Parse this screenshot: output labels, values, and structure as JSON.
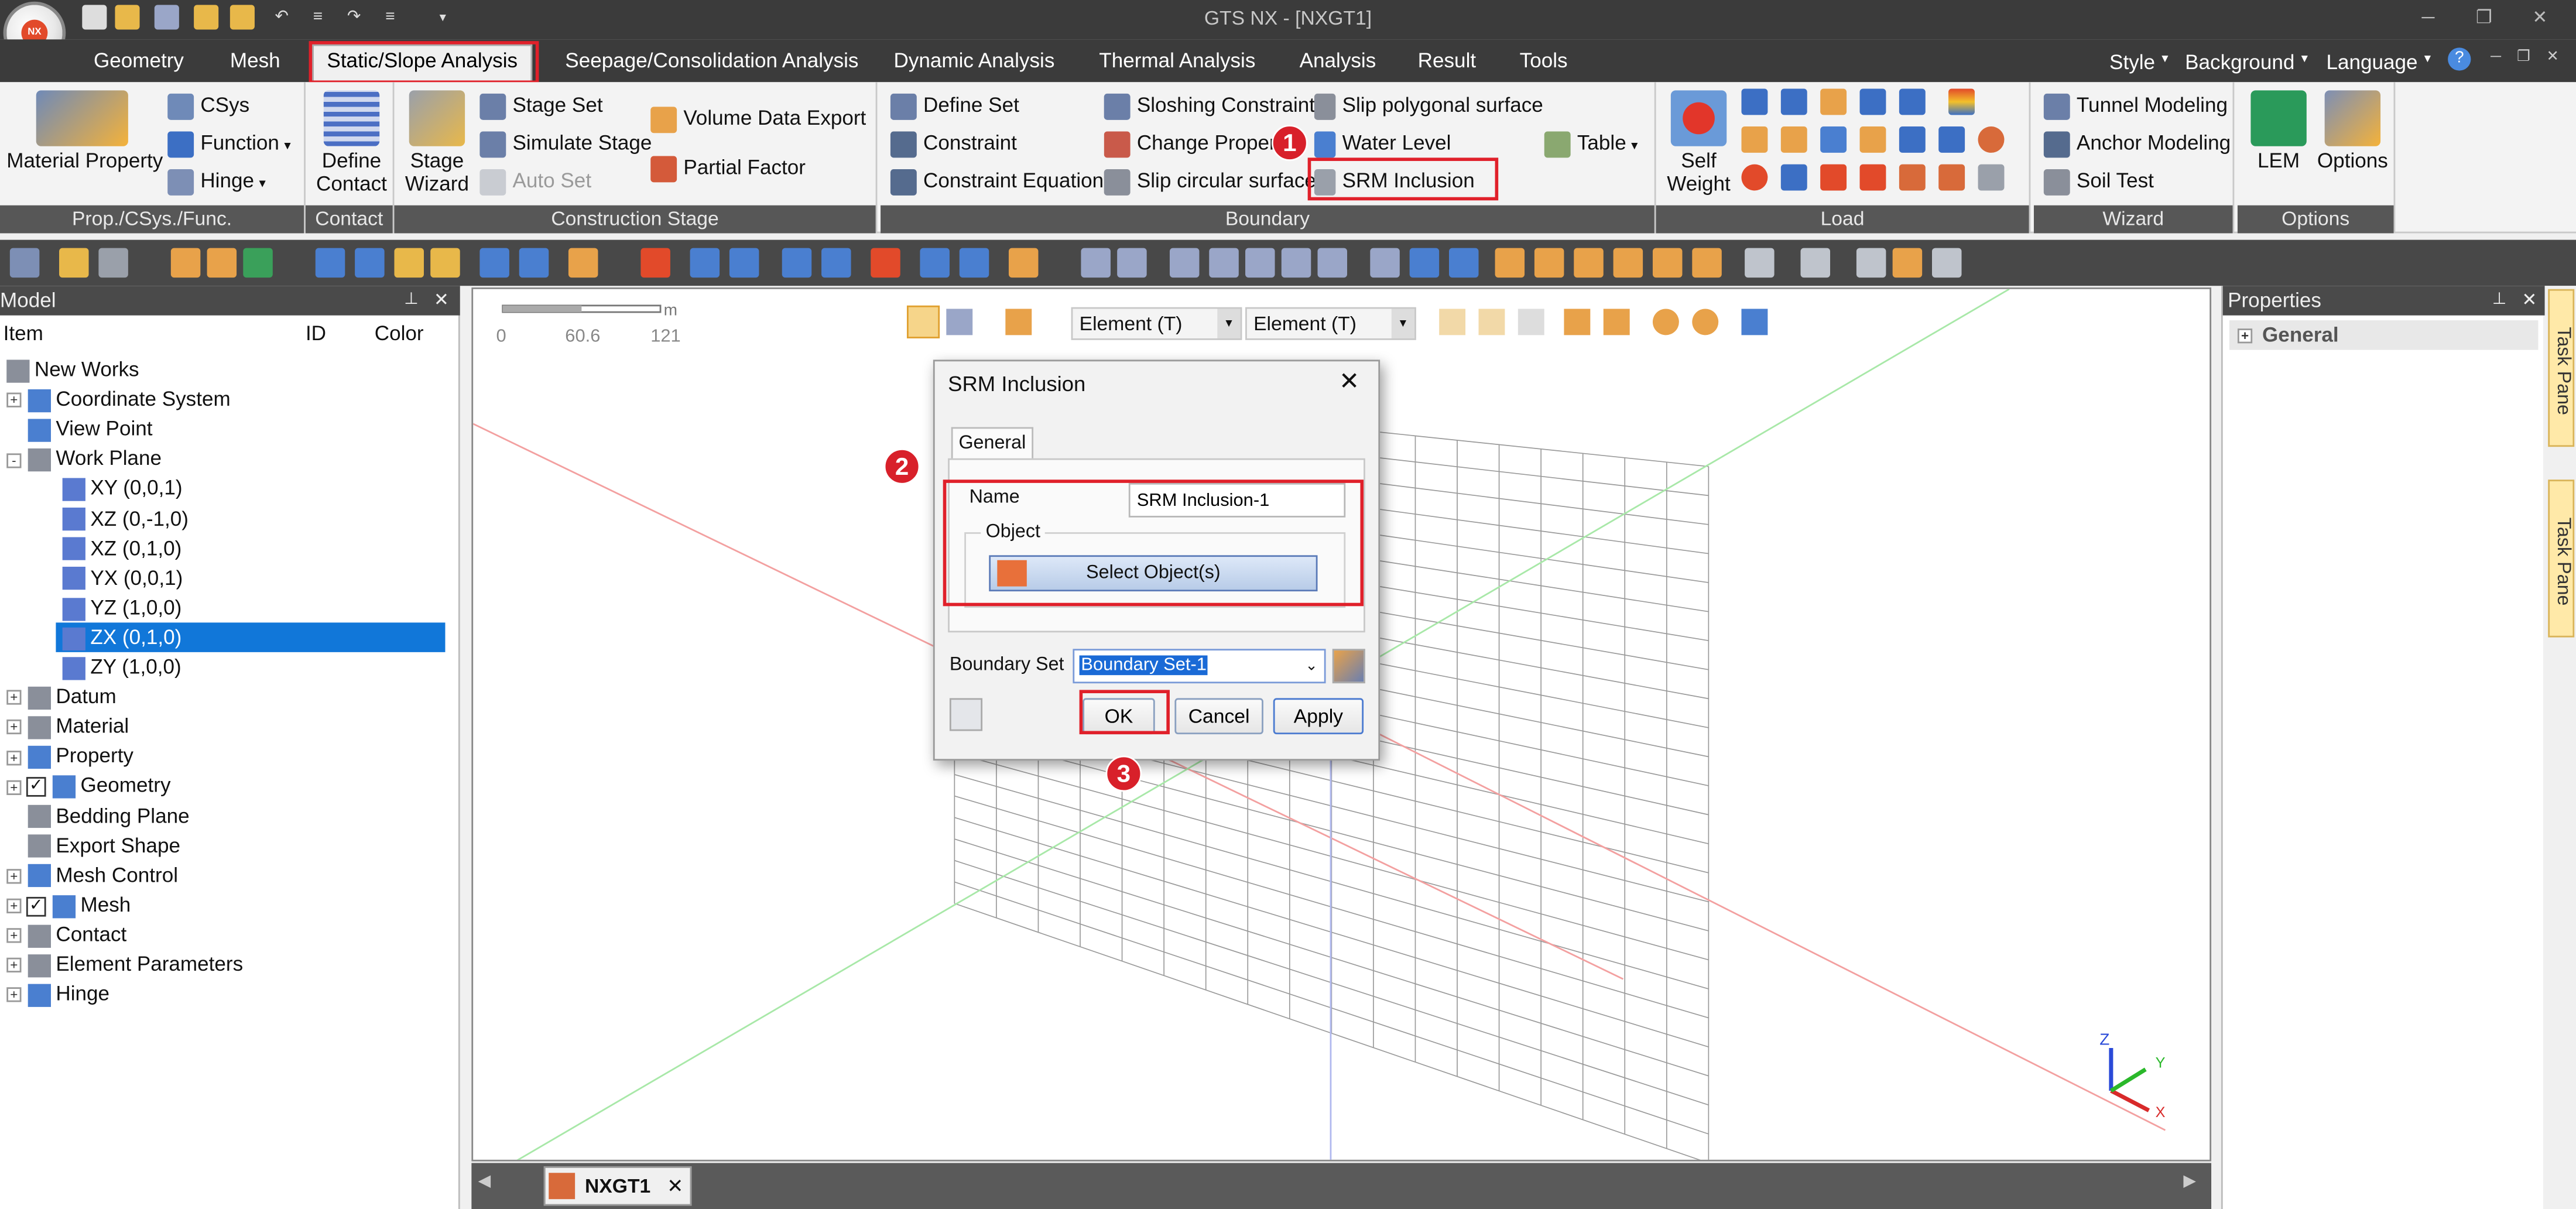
{
  "window": {
    "title": "GTS NX - [NXGT1]",
    "logo_text": "NX"
  },
  "menu": {
    "tabs": [
      "Geometry",
      "Mesh",
      "Static/Slope Analysis",
      "Seepage/Consolidation Analysis",
      "Dynamic Analysis",
      "Thermal Analysis",
      "Analysis",
      "Result",
      "Tools"
    ],
    "right": [
      "Style",
      "Background",
      "Language"
    ]
  },
  "ribbon": {
    "propcsys": {
      "material_property": "Material Property",
      "csys": "CSys",
      "function": "Function",
      "hinge": "Hinge",
      "label": "Prop./CSys./Func."
    },
    "contact": {
      "define": "Define",
      "contact": "Contact",
      "label": "Contact"
    },
    "construction": {
      "stage_wizard_1": "Stage",
      "stage_wizard_2": "Wizard",
      "stage_set": "Stage Set",
      "simulate_stage": "Simulate Stage",
      "auto_set": "Auto Set",
      "volume_data_export": "Volume Data Export",
      "partial_factor": "Partial Factor",
      "label": "Construction Stage"
    },
    "boundary": {
      "define_set": "Define Set",
      "constraint": "Constraint",
      "constraint_equation": "Constraint Equation",
      "sloshing_constraint": "Sloshing Constraint",
      "change_property": "Change Property",
      "slip_circular_surface": "Slip circular surface",
      "slip_polygonal_surface": "Slip polygonal surface",
      "water_level": "Water Level",
      "srm_inclusion": "SRM Inclusion",
      "table": "Table",
      "label": "Boundary"
    },
    "load": {
      "self_weight_1": "Self",
      "self_weight_2": "Weight",
      "label": "Load"
    },
    "wizard": {
      "tunnel_modeling": "Tunnel Modeling",
      "anchor_modeling": "Anchor Modeling",
      "soil_test": "Soil Test",
      "label": "Wizard"
    },
    "options": {
      "lem": "LEM",
      "options": "Options",
      "label": "Options"
    }
  },
  "model_panel": {
    "title": "Model",
    "columns": [
      "Item",
      "ID",
      "Color"
    ],
    "items": [
      {
        "label": "New Works",
        "level": 0,
        "expand": "",
        "check": false
      },
      {
        "label": "Coordinate System",
        "level": 1,
        "expand": "+",
        "check": false
      },
      {
        "label": "View Point",
        "level": 1,
        "expand": "",
        "check": false
      },
      {
        "label": "Work Plane",
        "level": 1,
        "expand": "-",
        "check": false
      },
      {
        "label": "XY (0,0,1)",
        "level": 2,
        "expand": "",
        "check": false
      },
      {
        "label": "XZ (0,-1,0)",
        "level": 2,
        "expand": "",
        "check": false
      },
      {
        "label": "XZ (0,1,0)",
        "level": 2,
        "expand": "",
        "check": false
      },
      {
        "label": "YX (0,0,1)",
        "level": 2,
        "expand": "",
        "check": false
      },
      {
        "label": "YZ (1,0,0)",
        "level": 2,
        "expand": "",
        "check": false
      },
      {
        "label": "ZX (0,1,0)",
        "level": 2,
        "expand": "",
        "check": false,
        "selected": true
      },
      {
        "label": "ZY (1,0,0)",
        "level": 2,
        "expand": "",
        "check": false
      },
      {
        "label": "Datum",
        "level": 1,
        "expand": "+",
        "check": false
      },
      {
        "label": "Material",
        "level": 1,
        "expand": "+",
        "check": false
      },
      {
        "label": "Property",
        "level": 1,
        "expand": "+",
        "check": false
      },
      {
        "label": "Geometry",
        "level": 1,
        "expand": "+",
        "check": true
      },
      {
        "label": "Bedding Plane",
        "level": 1,
        "expand": "",
        "check": false
      },
      {
        "label": "Export Shape",
        "level": 1,
        "expand": "",
        "check": false
      },
      {
        "label": "Mesh Control",
        "level": 1,
        "expand": "+",
        "check": false
      },
      {
        "label": "Mesh",
        "level": 1,
        "expand": "+",
        "check": true
      },
      {
        "label": "Contact",
        "level": 1,
        "expand": "+",
        "check": false
      },
      {
        "label": "Element Parameters",
        "level": 1,
        "expand": "+",
        "check": false
      },
      {
        "label": "Hinge",
        "level": 1,
        "expand": "+",
        "check": false
      }
    ]
  },
  "viewport": {
    "scale_unit": "m",
    "scale_ticks": [
      "0",
      "60.6",
      "121"
    ],
    "filter1": "Element (T)",
    "filter2": "Element (T)",
    "axes": {
      "z": "Z",
      "y": "Y",
      "x": "X"
    },
    "doc_tab": "NXGT1"
  },
  "dialog": {
    "title": "SRM Inclusion",
    "tab": "General",
    "name_label": "Name",
    "name_value": "SRM Inclusion-1",
    "object_label": "Object",
    "select_button": "Select Object(s)",
    "boundary_set_label": "Boundary Set",
    "boundary_set_value": "Boundary Set-1",
    "ok": "OK",
    "cancel": "Cancel",
    "apply": "Apply"
  },
  "properties_panel": {
    "title": "Properties",
    "section": "General"
  },
  "task_pane": {
    "label": "Task Pane"
  },
  "annotations": [
    "1",
    "2",
    "3"
  ],
  "colors": {
    "highlight": "#e0202a",
    "selection": "#1177d9",
    "dark_bar": "#3b3b3b",
    "group_label": "#575757"
  }
}
